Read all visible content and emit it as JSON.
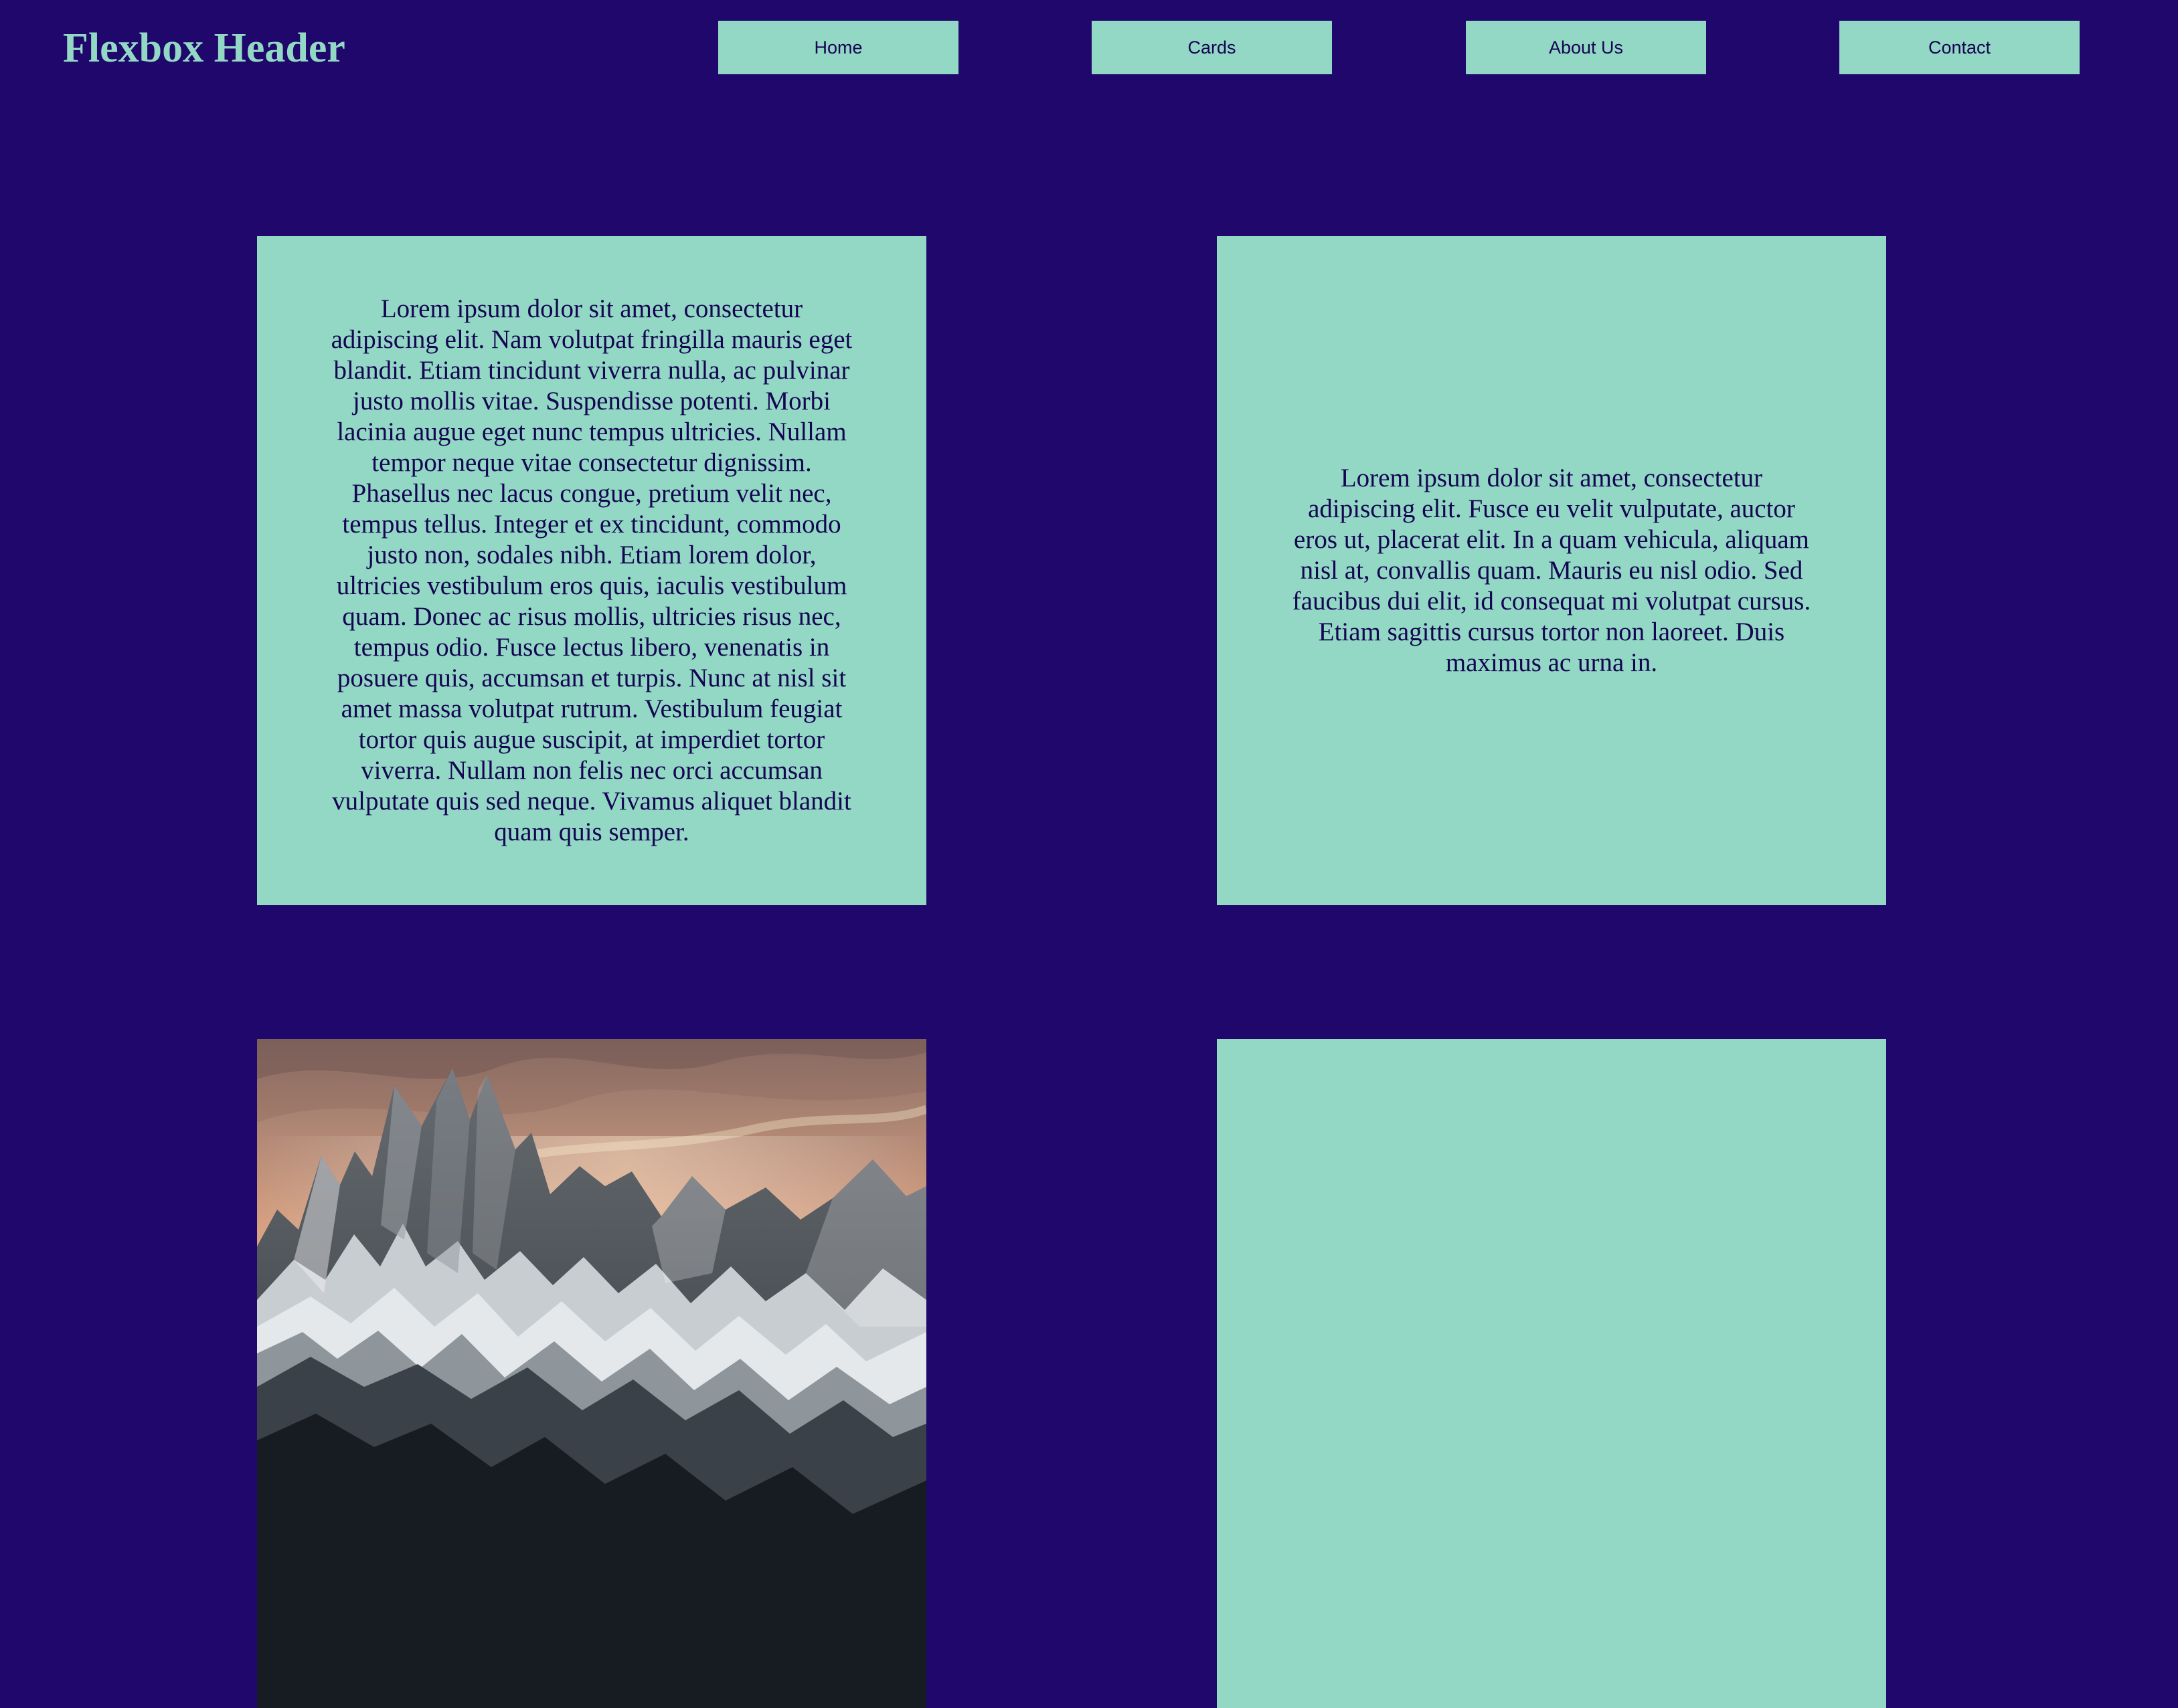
{
  "header": {
    "title": "Flexbox Header",
    "nav": [
      {
        "label": "Home"
      },
      {
        "label": "Cards"
      },
      {
        "label": "About Us"
      },
      {
        "label": "Contact"
      }
    ]
  },
  "cards": [
    {
      "text": "Lorem ipsum dolor sit amet, consectetur adipiscing elit. Nam volutpat fringilla mauris eget blandit. Etiam tincidunt viverra nulla, ac pulvinar justo mollis vitae. Suspendisse potenti. Morbi lacinia augue eget nunc tempus ultricies. Nullam tempor neque vitae consectetur dignissim. Phasellus nec lacus congue, pretium velit nec, tempus tellus. Integer et ex tincidunt, commodo justo non, sodales nibh. Etiam lorem dolor, ultricies vestibulum eros quis, iaculis vestibulum quam. Donec ac risus mollis, ultricies risus nec, tempus odio. Fusce lectus libero, venenatis in posuere quis, accumsan et turpis. Nunc at nisl sit amet massa volutpat rutrum. Vestibulum feugiat tortor quis augue suscipit, at imperdiet tortor viverra. Nullam non felis nec orci accumsan vulputate quis sed neque. Vivamus aliquet blandit quam quis semper."
    },
    {
      "text": "Lorem ipsum dolor sit amet, consectetur adipiscing elit. Fusce eu velit vulputate, auctor eros ut, placerat elit. In a quam vehicula, aliquam nisl at, convallis quam. Mauris eu nisl odio. Sed faucibus dui elit, id consequat mi volutpat cursus. Etiam sagittis cursus tortor non laoreet. Duis maximus ac urna in."
    },
    {
      "image": "mountain-landscape"
    },
    {
      "text": ""
    }
  ],
  "colors": {
    "background": "#1f076b",
    "accent": "#92d8c5",
    "text_dark": "#150552"
  }
}
